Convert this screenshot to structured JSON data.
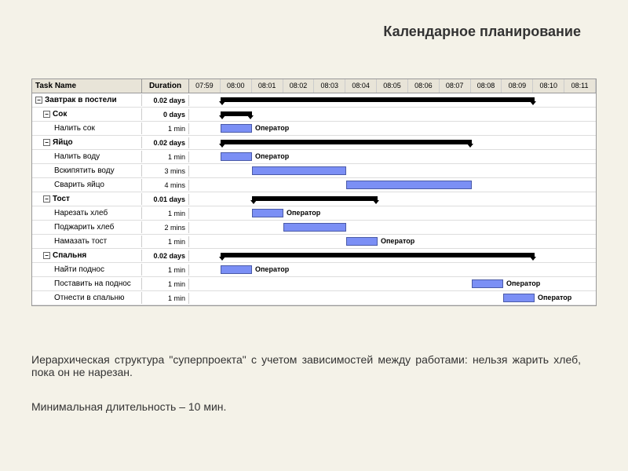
{
  "title": "Календарное планирование",
  "columns": {
    "name": "Task Name",
    "duration": "Duration"
  },
  "timescale": [
    "07:59",
    "08:00",
    "08:01",
    "08:02",
    "08:03",
    "08:04",
    "08:05",
    "08:06",
    "08:07",
    "08:08",
    "08:09",
    "08:10",
    "08:11"
  ],
  "operator_label": "Оператор",
  "tasks": [
    {
      "name": "Завтрак в постели",
      "duration": "0.02 days",
      "level": 0,
      "summary": true,
      "bar_start": 1,
      "bar_len": 10
    },
    {
      "name": "Сок",
      "duration": "0 days",
      "level": 1,
      "summary": true,
      "bar_start": 1,
      "bar_len": 1
    },
    {
      "name": "Налить сок",
      "duration": "1 min",
      "level": 2,
      "bar_start": 1,
      "bar_len": 1,
      "label": "Оператор"
    },
    {
      "name": "Яйцо",
      "duration": "0.02 days",
      "level": 1,
      "summary": true,
      "bar_start": 1,
      "bar_len": 8
    },
    {
      "name": "Налить воду",
      "duration": "1 min",
      "level": 2,
      "bar_start": 1,
      "bar_len": 1,
      "label": "Оператор"
    },
    {
      "name": "Вскипятить воду",
      "duration": "3 mins",
      "level": 2,
      "bar_start": 2,
      "bar_len": 3
    },
    {
      "name": "Сварить яйцо",
      "duration": "4 mins",
      "level": 2,
      "bar_start": 5,
      "bar_len": 4
    },
    {
      "name": "Тост",
      "duration": "0.01 days",
      "level": 1,
      "summary": true,
      "bar_start": 2,
      "bar_len": 4
    },
    {
      "name": "Нарезать хлеб",
      "duration": "1 min",
      "level": 2,
      "bar_start": 2,
      "bar_len": 1,
      "label": "Оператор"
    },
    {
      "name": "Поджарить хлеб",
      "duration": "2 mins",
      "level": 2,
      "bar_start": 3,
      "bar_len": 2
    },
    {
      "name": "Намазать тост",
      "duration": "1 min",
      "level": 2,
      "bar_start": 5,
      "bar_len": 1,
      "label": "Оператор"
    },
    {
      "name": "Спальня",
      "duration": "0.02 days",
      "level": 1,
      "summary": true,
      "bar_start": 1,
      "bar_len": 10
    },
    {
      "name": "Найти поднос",
      "duration": "1 min",
      "level": 2,
      "bar_start": 1,
      "bar_len": 1,
      "label": "Оператор"
    },
    {
      "name": "Поставить на поднос",
      "duration": "1 min",
      "level": 2,
      "bar_start": 9,
      "bar_len": 1,
      "label": "Оператор"
    },
    {
      "name": "Отнести в спальню",
      "duration": "1 min",
      "level": 2,
      "bar_start": 10,
      "bar_len": 1,
      "label": "Оператор"
    }
  ],
  "caption1": "Иерархическая структура \"суперпроекта\" с учетом зависимостей между работами: нельзя жарить хлеб, пока он не нарезан.",
  "caption2": "Минимальная длительность – 10 мин."
}
